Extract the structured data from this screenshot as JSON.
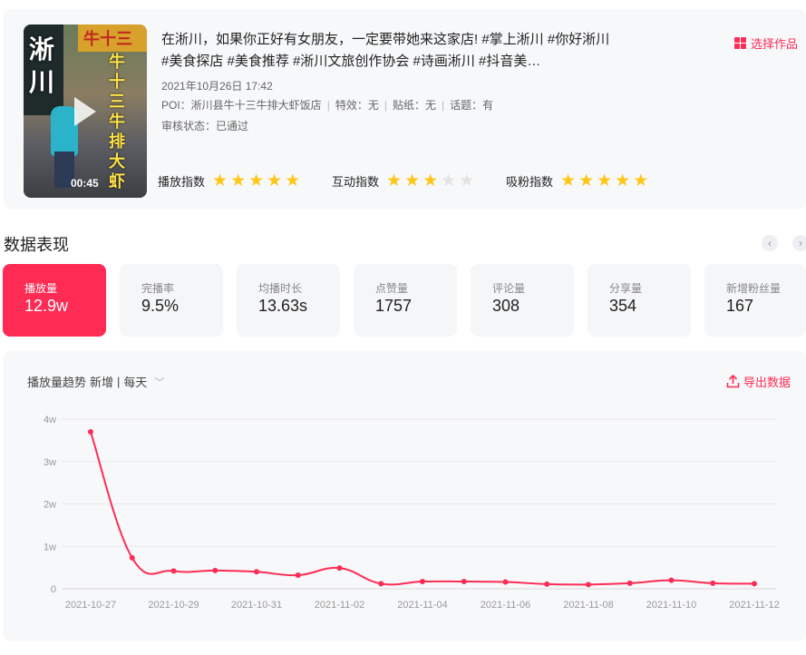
{
  "video": {
    "duration": "00:45",
    "thumb_text_vertical": "淅川",
    "thumb_text_top": "牛十三",
    "thumb_text_side": "牛十三牛排大虾",
    "title": "在淅川，如果你正好有女朋友，一定要带她来这家店! #掌上淅川 #你好淅川 #美食探店 #美食推荐 #淅川文旅创作协会 #诗画淅川 #抖音美…",
    "date": "2021年10月26日 17:42",
    "poi": "POI：淅川县牛十三牛排大虾饭店",
    "effect": "特效：无",
    "sticker": "贴纸：无",
    "topic": "话题：有",
    "status": "审核状态：已通过",
    "choose_label": "选择作品",
    "ratings": [
      {
        "label": "播放指数",
        "score": 5,
        "max": 5
      },
      {
        "label": "互动指数",
        "score": 3,
        "max": 5
      },
      {
        "label": "吸粉指数",
        "score": 5,
        "max": 5
      }
    ]
  },
  "performance": {
    "title": "数据表现",
    "prev_icon": "chevron-left-icon",
    "next_icon": "chevron-right-icon",
    "metrics": [
      {
        "label": "播放量",
        "value": "12.9w",
        "active": true
      },
      {
        "label": "完播率",
        "value": "9.5%"
      },
      {
        "label": "均播时长",
        "value": "13.63s"
      },
      {
        "label": "点赞量",
        "value": "1757"
      },
      {
        "label": "评论量",
        "value": "308"
      },
      {
        "label": "分享量",
        "value": "354"
      },
      {
        "label": "新增粉丝量",
        "value": "167"
      }
    ]
  },
  "trend": {
    "title": "播放量趋势",
    "mode": "新增",
    "separator": "|",
    "period": "每天",
    "export_label": "导出数据",
    "accent": "#fe2c55"
  },
  "chart_data": {
    "type": "line",
    "title": "",
    "xlabel": "",
    "ylabel": "",
    "ylim": [
      0,
      40000
    ],
    "y_ticks": [
      {
        "value": 0,
        "label": "0"
      },
      {
        "value": 10000,
        "label": "1w"
      },
      {
        "value": 20000,
        "label": "2w"
      },
      {
        "value": 30000,
        "label": "3w"
      },
      {
        "value": 40000,
        "label": "4w"
      }
    ],
    "x_tick_labels": [
      "2021-10-27",
      "2021-10-29",
      "2021-10-31",
      "2021-11-02",
      "2021-11-04",
      "2021-11-06",
      "2021-11-08",
      "2021-11-10",
      "2021-11-12"
    ],
    "x": [
      "2021-10-27",
      "2021-10-28",
      "2021-10-29",
      "2021-10-30",
      "2021-10-31",
      "2021-11-01",
      "2021-11-02",
      "2021-11-03",
      "2021-11-04",
      "2021-11-05",
      "2021-11-06",
      "2021-11-07",
      "2021-11-08",
      "2021-11-09",
      "2021-11-10",
      "2021-11-11",
      "2021-11-12"
    ],
    "series": [
      {
        "values": [
          37000,
          7300,
          4200,
          4300,
          4000,
          3200,
          4900,
          1200,
          1700,
          1700,
          1600,
          1100,
          1000,
          1300,
          2000,
          1300,
          1200
        ],
        "color": "#fe2c55"
      }
    ],
    "grid": true,
    "legend": "none"
  }
}
